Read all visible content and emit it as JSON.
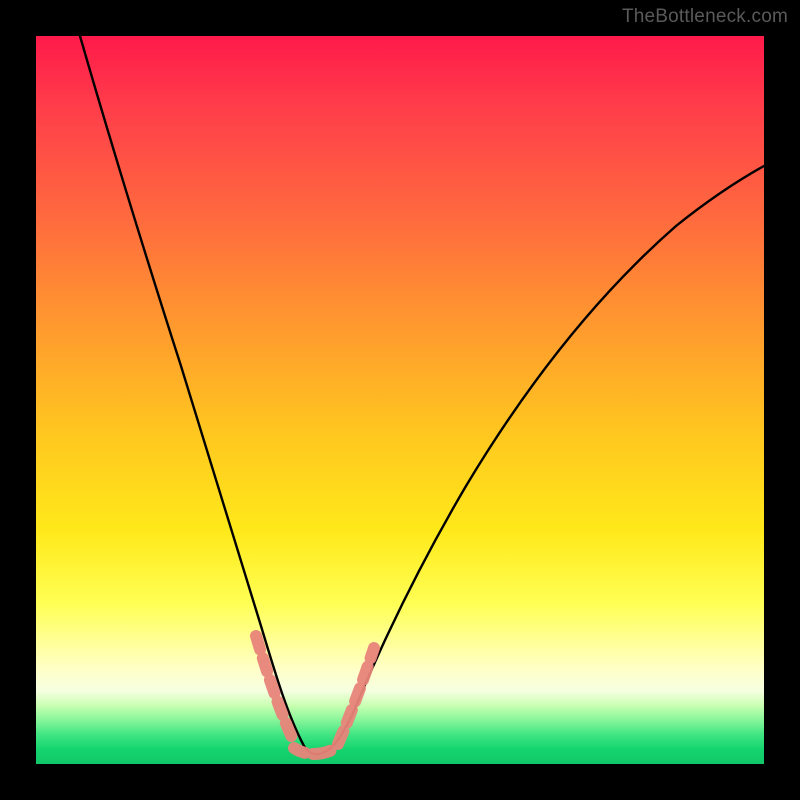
{
  "watermark": "TheBottleneck.com",
  "colors": {
    "gradient_top": "#ff1a4a",
    "gradient_mid": "#ffe91a",
    "gradient_bottom": "#11c768",
    "curve": "#000000",
    "bead": "#e8847a",
    "frame": "#000000"
  },
  "chart_data": {
    "type": "line",
    "title": "",
    "xlabel": "",
    "ylabel": "",
    "xlim": [
      0,
      100
    ],
    "ylim": [
      0,
      100
    ],
    "grid": false,
    "legend": false,
    "note": "Background heat gradient: red (top) = high bottleneck, green (bottom) = low bottleneck. Curve is a V-shaped bottleneck profile with minimum near x≈37.",
    "series": [
      {
        "name": "bottleneck-curve",
        "x": [
          6,
          10,
          14,
          18,
          22,
          26,
          30,
          33,
          35,
          37,
          39,
          41,
          44,
          50,
          58,
          68,
          80,
          92,
          100
        ],
        "y": [
          100,
          87,
          74,
          61,
          48,
          35,
          22,
          12,
          6,
          2,
          4,
          8,
          14,
          24,
          37,
          51,
          64,
          73,
          78
        ]
      }
    ],
    "markers": [
      {
        "name": "bead-cluster-left",
        "x_range": [
          29,
          35
        ],
        "y_range": [
          6,
          20
        ]
      },
      {
        "name": "bead-cluster-bottom",
        "x_range": [
          34,
          41
        ],
        "y_range": [
          2,
          4
        ]
      },
      {
        "name": "bead-cluster-right",
        "x_range": [
          41,
          46
        ],
        "y_range": [
          8,
          18
        ]
      }
    ]
  }
}
